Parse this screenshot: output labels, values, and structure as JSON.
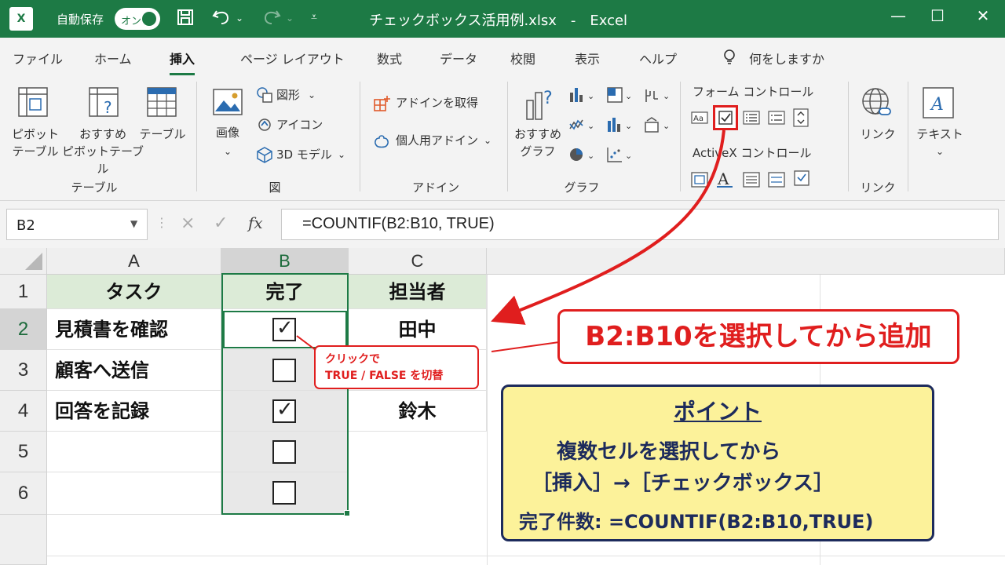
{
  "titlebar": {
    "app_icon": "X",
    "autosave_label": "自動保存",
    "autosave_toggle": "オン",
    "document_title": "チェックボックス活用例.xlsx　-　Excel"
  },
  "menu": {
    "tabs": [
      "ファイル",
      "ホーム",
      "挿入",
      "ページ レイアウト",
      "数式",
      "データ",
      "校閲",
      "表示",
      "ヘルプ"
    ],
    "active_tab": "挿入",
    "search_placeholder": "何をしますか"
  },
  "ribbon": {
    "table_group": {
      "pivot_table": [
        "ピボット",
        "テーブル"
      ],
      "recommended_pivot": [
        "おすすめ",
        "ピボットテーブル"
      ],
      "table": "テーブル",
      "label": "テーブル"
    },
    "illustrations_group": {
      "image": "画像",
      "shapes": "図形",
      "icons": "アイコン",
      "models_3d": "3D モデル",
      "label": "図"
    },
    "addins_group": {
      "get_addins": "アドインを取得",
      "my_addins": "個人用アドイン",
      "label": "アドイン"
    },
    "charts_group": {
      "recommended_charts": [
        "おすすめ",
        "グラフ"
      ],
      "label": "グラフ"
    },
    "controls_group": {
      "form_controls": "フォーム コントロール",
      "activex_controls": "ActiveX コントロール"
    },
    "link_group": {
      "link": "リンク",
      "label": "リンク"
    },
    "text_group": {
      "text": "テキスト"
    }
  },
  "formula_bar": {
    "name_box": "B2",
    "cancel_icon": "×",
    "enter_icon": "✓",
    "fx": "fx",
    "formula": "=COUNTIF(B2:B10, TRUE)"
  },
  "sheet": {
    "columns": [
      "A",
      "B",
      "C"
    ],
    "rows": [
      "1",
      "2",
      "3",
      "4",
      "5",
      "6"
    ],
    "headers": {
      "a1": "タスク",
      "b1": "完了",
      "c1": "担当者"
    },
    "tasks": [
      "見積書を確認",
      "顧客へ送信",
      "回答を記録"
    ],
    "assignees": {
      "c2": "田中",
      "c4": "鈴木"
    },
    "checkboxes": [
      true,
      false,
      true,
      false,
      false
    ],
    "check_glyph": "✓"
  },
  "annotations": {
    "red_callout": "B2:B10を選択してから追加",
    "small_callout_line1": "クリックで",
    "small_callout_line2": "TRUE / FALSE を切替",
    "point_title": "ポイント",
    "point_line1": "複数セルを選択してから",
    "point_line2": "［挿入］→［チェックボックス］",
    "point_line3": "完了件数: =COUNTIF(B2:B10,TRUE)"
  },
  "colors": {
    "excel_green": "#1d7a45",
    "highlight_red": "#e01e1e",
    "header_fill": "#dcebd7",
    "point_fill": "#fcf29a",
    "point_border": "#1d2b5c"
  }
}
